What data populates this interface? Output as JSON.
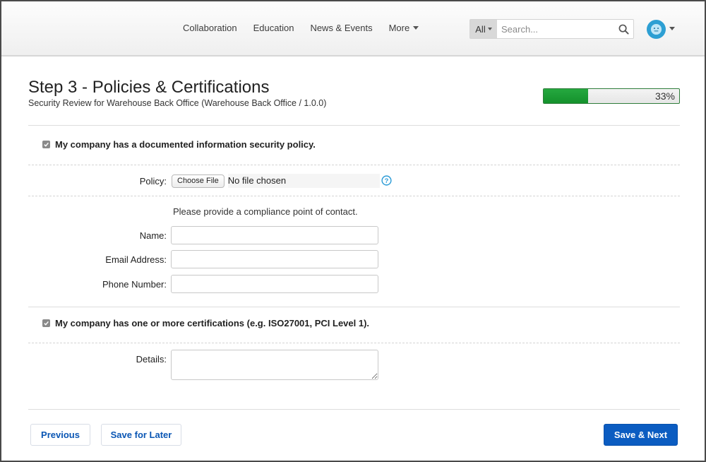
{
  "header": {
    "nav": [
      {
        "label": "Collaboration"
      },
      {
        "label": "Education"
      },
      {
        "label": "News & Events"
      },
      {
        "label": "More",
        "has_dropdown": true
      }
    ],
    "search": {
      "scope_label": "All",
      "placeholder": "Search...",
      "value": "",
      "icon": "search-icon"
    },
    "avatar": {
      "icon": "smiley-user-icon",
      "color": "#2d9fd3"
    }
  },
  "page": {
    "title": "Step 3 - Policies & Certifications",
    "subtitle": "Security Review for Warehouse Back Office (Warehouse Back Office / 1.0.0)",
    "progress": {
      "percent": 33,
      "label": "33%",
      "color": "#1e9e36"
    }
  },
  "form": {
    "policy_section": {
      "checkbox_label": "My company has a documented information security policy.",
      "checked": true,
      "policy_label": "Policy:",
      "file_button_label": "Choose File",
      "file_status": "No file chosen",
      "help_icon": "question-circle-icon",
      "instructions": "Please provide a compliance point of contact.",
      "fields": [
        {
          "label": "Name:",
          "value": ""
        },
        {
          "label": "Email Address:",
          "value": ""
        },
        {
          "label": "Phone Number:",
          "value": ""
        }
      ]
    },
    "cert_section": {
      "checkbox_label": "My company has one or more certifications (e.g. ISO27001, PCI Level 1).",
      "checked": true,
      "details_label": "Details:",
      "details_value": ""
    }
  },
  "footer": {
    "previous_label": "Previous",
    "save_later_label": "Save for Later",
    "save_next_label": "Save & Next",
    "primary_color": "#0b5cc1"
  }
}
